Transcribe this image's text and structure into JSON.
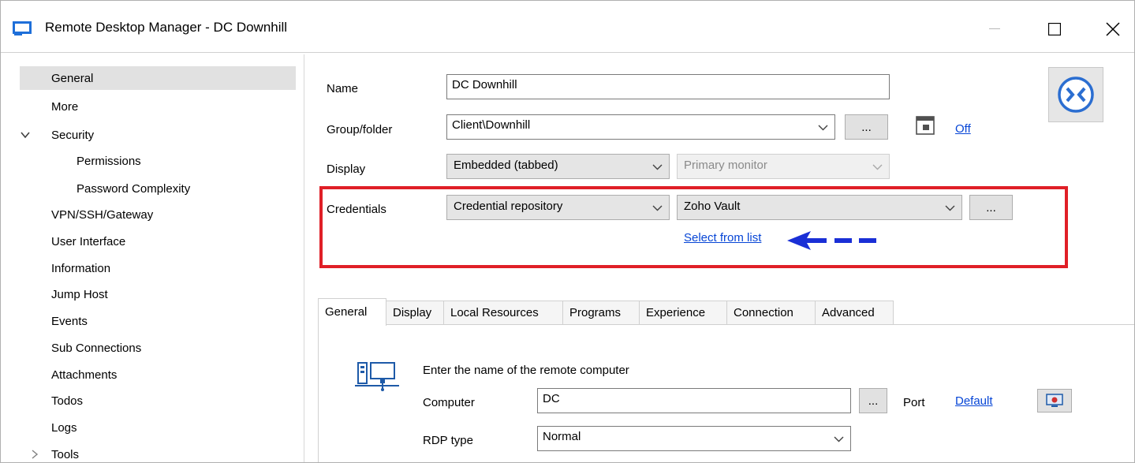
{
  "window": {
    "title": "Remote Desktop Manager - DC Downhill",
    "icon": "monitor-icon"
  },
  "sidebar": {
    "items": [
      {
        "label": "General"
      },
      {
        "label": "More"
      },
      {
        "label": "Security"
      },
      {
        "label": "Permissions"
      },
      {
        "label": "Password Complexity"
      },
      {
        "label": "VPN/SSH/Gateway"
      },
      {
        "label": "User Interface"
      },
      {
        "label": "Information"
      },
      {
        "label": "Jump Host"
      },
      {
        "label": "Events"
      },
      {
        "label": "Sub Connections"
      },
      {
        "label": "Attachments"
      },
      {
        "label": "Todos"
      },
      {
        "label": "Logs"
      },
      {
        "label": "Tools"
      }
    ]
  },
  "form": {
    "name_label": "Name",
    "name_value": "DC Downhill",
    "group_label": "Group/folder",
    "group_value": "Client\\Downhill",
    "group_browse": "...",
    "off_link": "Off",
    "display_label": "Display",
    "display_value": "Embedded (tabbed)",
    "monitor_value": "Primary monitor",
    "credentials_label": "Credentials",
    "credentials_type": "Credential repository",
    "credentials_entry": "Zoho Vault",
    "credentials_browse": "...",
    "select_from_list": "Select from list"
  },
  "tabs": [
    {
      "label": "General"
    },
    {
      "label": "Display"
    },
    {
      "label": "Local Resources"
    },
    {
      "label": "Programs"
    },
    {
      "label": "Experience"
    },
    {
      "label": "Connection"
    },
    {
      "label": "Advanced"
    }
  ],
  "general_tab": {
    "heading": "Enter the name of the remote computer",
    "computer_label": "Computer",
    "computer_value": "DC",
    "computer_browse": "...",
    "port_label": "Port",
    "port_link": "Default",
    "rdp_type_label": "RDP type",
    "rdp_type_value": "Normal"
  },
  "colors": {
    "highlight": "#e01f27",
    "arrow": "#1a2fd6",
    "link": "#0645d6",
    "accent": "#2b6ed1"
  }
}
